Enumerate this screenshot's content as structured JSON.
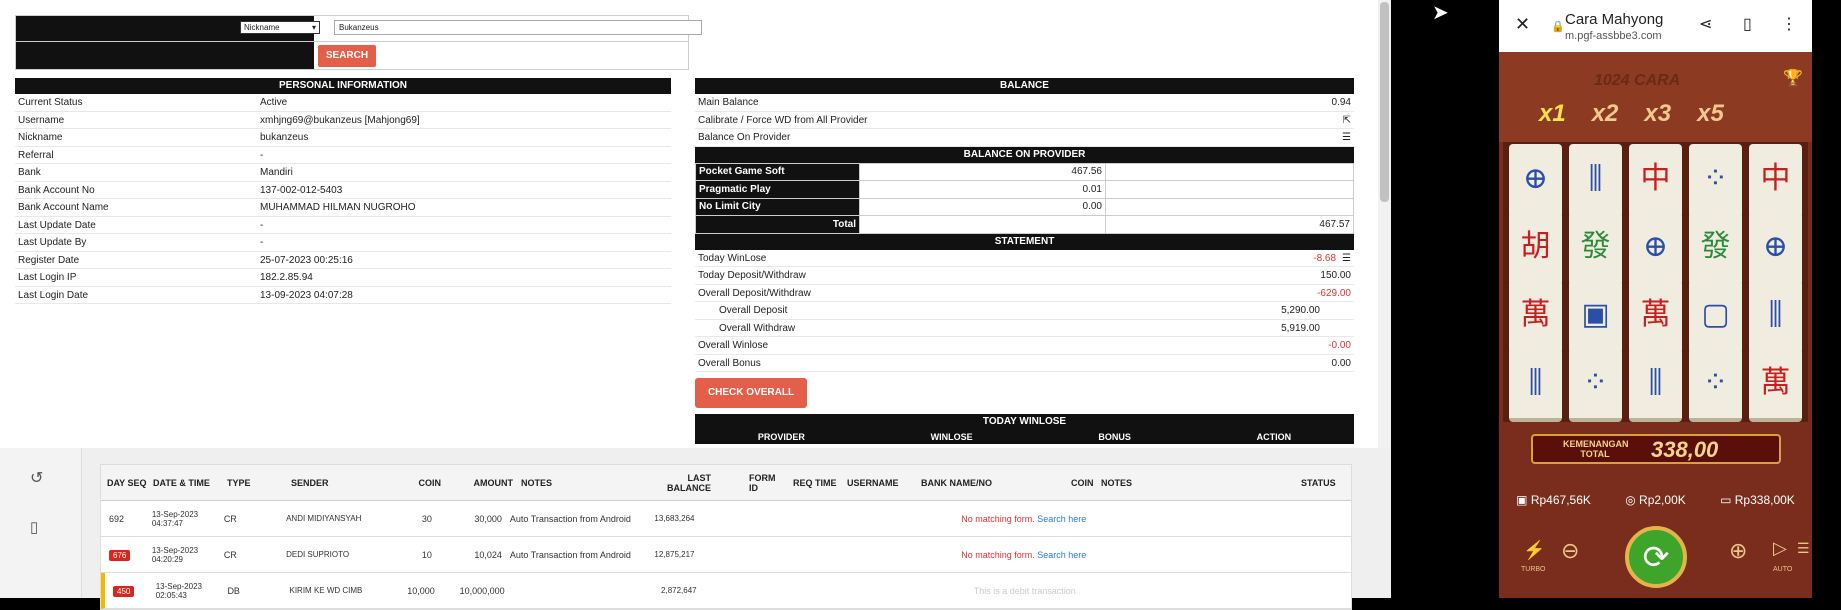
{
  "search": {
    "dropdown_value": "Nickname",
    "input_value": "Bukanzeus",
    "button": "SEARCH"
  },
  "personal": {
    "title": "PERSONAL INFORMATION",
    "rows": [
      {
        "k": "Current Status",
        "v": "Active"
      },
      {
        "k": "Username",
        "v": "xmhjng69@bukanzeus  [Mahjong69]"
      },
      {
        "k": "Nickname",
        "v": "bukanzeus"
      },
      {
        "k": "Referral",
        "v": "-"
      },
      {
        "k": "Bank",
        "v": "Mandiri"
      },
      {
        "k": "Bank Account No",
        "v": "137-002-012-5403"
      },
      {
        "k": "Bank Account Name",
        "v": "MUHAMMAD HILMAN NUGROHO"
      },
      {
        "k": "Last Update Date",
        "v": "-"
      },
      {
        "k": "Last Update By",
        "v": "-"
      },
      {
        "k": "Register Date",
        "v": "25-07-2023 00:25:16"
      },
      {
        "k": "Last Login IP",
        "v": "182.2.85.94"
      },
      {
        "k": "Last Login Date",
        "v": "13-09-2023 04:07:28"
      }
    ]
  },
  "balance": {
    "title": "BALANCE",
    "main_label": "Main Balance",
    "main_value": "0.94",
    "calibrate_label": "Calibrate / Force WD from All Provider",
    "bop_label": "Balance On Provider",
    "provider_title": "BALANCE ON PROVIDER",
    "providers": [
      {
        "name": "Pocket Game Soft",
        "value": "467.56"
      },
      {
        "name": "Pragmatic Play",
        "value": "0.01"
      },
      {
        "name": "No Limit City",
        "value": "0.00"
      }
    ],
    "total_label": "Total",
    "total_value": "467.57",
    "statement_title": "STATEMENT",
    "statement": [
      {
        "k": "Today WinLose",
        "v": "-8.68",
        "red": true
      },
      {
        "k": "Today Deposit/Withdraw",
        "v": "150.00"
      },
      {
        "k": "Overall Deposit/Withdraw",
        "v": "-629.00",
        "red": true
      }
    ],
    "overall_deposit_label": "Overall Deposit",
    "overall_deposit": "5,290.00",
    "overall_withdraw_label": "Overall Withdraw",
    "overall_withdraw": "5,919.00",
    "overall_winlose_label": "Overall Winlose",
    "overall_winlose": "-0.00",
    "overall_bonus_label": "Overall Bonus",
    "overall_bonus": "0.00",
    "check_button": "CHECK OVERALL",
    "today_winlose_title": "TODAY WINLOSE",
    "today_cols": [
      "PROVIDER",
      "WINLOSE",
      "BONUS",
      "ACTION"
    ]
  },
  "transactions": {
    "headers": {
      "dayseq": "DAY SEQ",
      "date": "DATE & TIME",
      "type": "TYPE",
      "sender": "SENDER",
      "coin": "COIN",
      "amount": "AMOUNT",
      "notes": "NOTES",
      "last_balance": "LAST BALANCE",
      "form_id": "FORM ID",
      "req_time": "REQ TIME",
      "username": "USERNAME",
      "bank": "BANK NAME/NO",
      "coin2": "COIN",
      "notes2": "NOTES",
      "status": "STATUS"
    },
    "rows": [
      {
        "seq": "692",
        "date": "13-Sep-2023 04:37:47",
        "type": "CR",
        "sender": "ANDI MIDIYANSYAH",
        "coin": "30",
        "amount": "30,000",
        "notes": "Auto Transaction from Android",
        "bal": "13,683,264",
        "msg": "No matching form.",
        "link": "Search here"
      },
      {
        "seq": "676",
        "date": "13-Sep-2023 04:20:29",
        "type": "CR",
        "sender": "DEDI SUPRIOTO",
        "coin": "10",
        "amount": "10,024",
        "notes": "Auto Transaction from Android",
        "bal": "12,875,217",
        "msg": "No matching form.",
        "link": "Search here"
      },
      {
        "seq": "450",
        "date": "13-Sep-2023 02:05:43",
        "type": "DB",
        "sender": "KIRIM KE WD CIMB",
        "coin": "10,000",
        "amount": "10,000,000",
        "notes": "",
        "bal": "2,872,647",
        "msg": "This is a debit transaction",
        "link": ""
      }
    ]
  },
  "phone": {
    "title": "Cara Mahyong",
    "url": "m.pgf-assbbe3.com",
    "ways": "1024 CARA",
    "multipliers": [
      "x1",
      "x2",
      "x3",
      "x5"
    ],
    "win_label": "KEMENANGAN TOTAL",
    "win_value": "338,00",
    "balance": "Rp467,56K",
    "bet": "Rp2,00K",
    "win": "Rp338,00K",
    "turbo": "TURBO",
    "auto": "AUTO"
  },
  "colors": {
    "accent": "#e35f4a",
    "header": "#111111",
    "negative": "#dd3333"
  }
}
